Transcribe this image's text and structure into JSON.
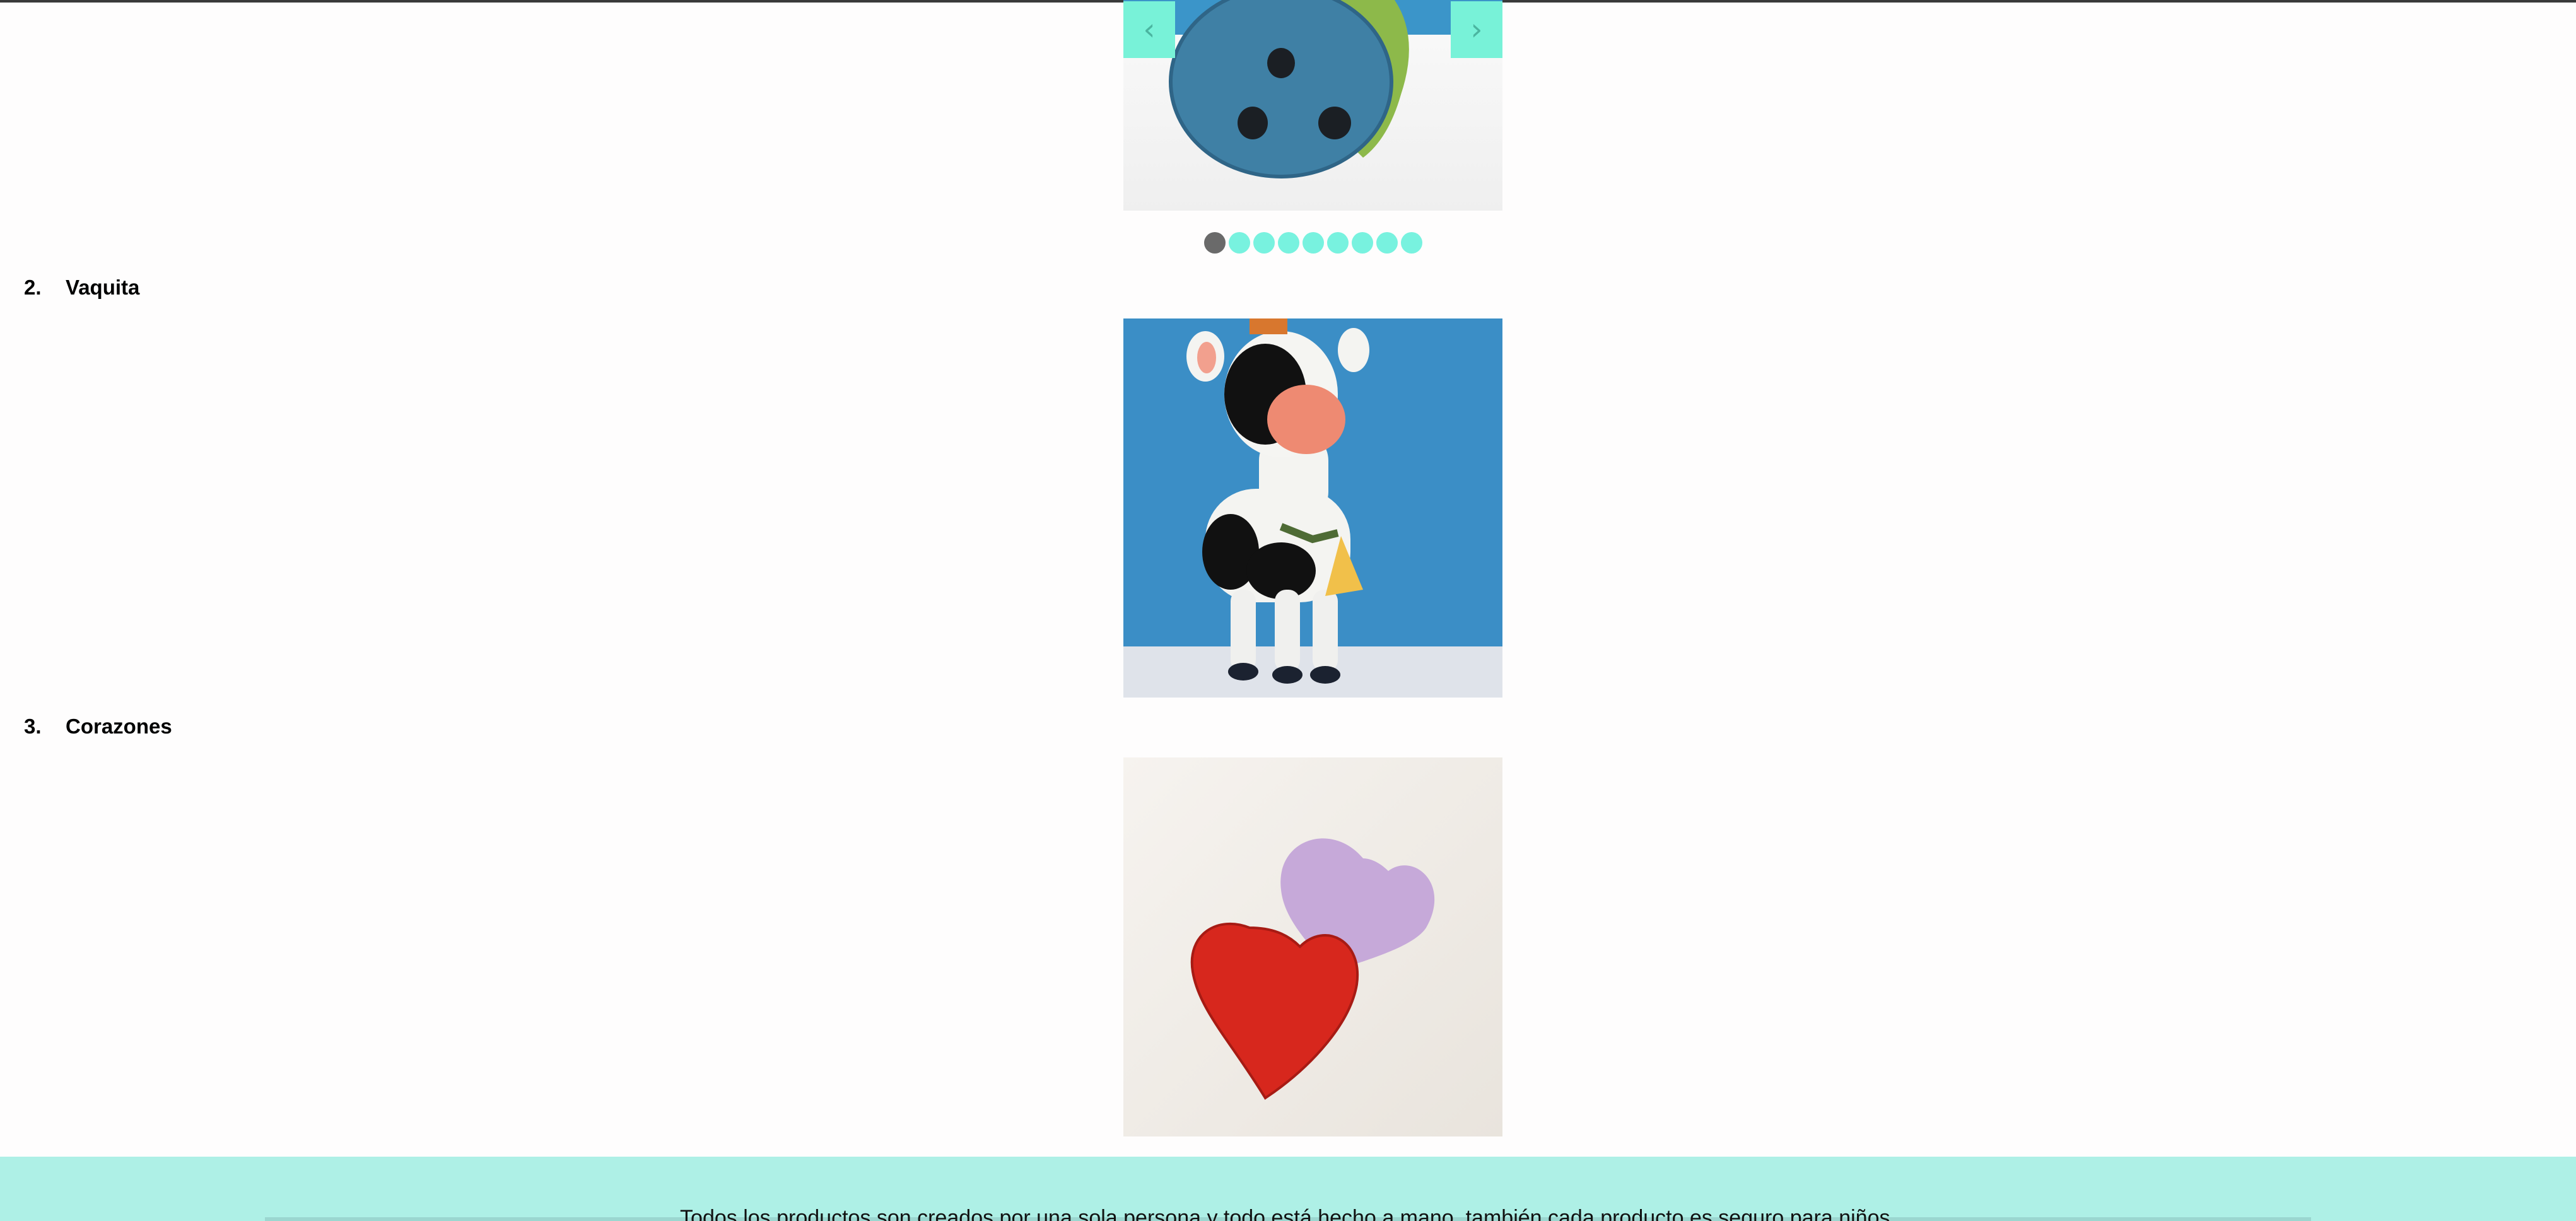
{
  "carousel": {
    "prev_label": "‹",
    "next_label": "›",
    "dot_count": 9,
    "active_index": 0
  },
  "products": [
    {
      "number": "2.",
      "name": "Vaquita"
    },
    {
      "number": "3.",
      "name": "Corazones"
    }
  ],
  "footer": {
    "text": "Todos los productos son creados por una sola persona y todo está hecho a mano, también cada producto es seguro para niños."
  },
  "colors": {
    "accent": "#78f2d8",
    "footer_bg": "#aef0e6",
    "active_dot": "#6a6a6a"
  }
}
